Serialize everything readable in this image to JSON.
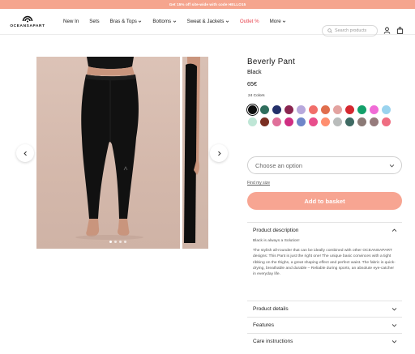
{
  "promo": {
    "text": "Get 15% off site-wide with code HELLO15"
  },
  "header": {
    "logo_text": "OCEANSAPART",
    "nav": [
      {
        "label": "New In",
        "dropdown": false,
        "highlight": false
      },
      {
        "label": "Sets",
        "dropdown": false,
        "highlight": false
      },
      {
        "label": "Bras & Tops",
        "dropdown": true,
        "highlight": false
      },
      {
        "label": "Bottoms",
        "dropdown": true,
        "highlight": false
      },
      {
        "label": "Sweat & Jackets",
        "dropdown": true,
        "highlight": false
      },
      {
        "label": "Outlet %",
        "dropdown": false,
        "highlight": true
      },
      {
        "label": "More",
        "dropdown": true,
        "highlight": false
      }
    ],
    "search_placeholder": "Search products",
    "icons": [
      "search-icon",
      "user-icon",
      "bag-icon"
    ]
  },
  "gallery": {
    "slide_count": 4,
    "active_slide": 1
  },
  "product": {
    "title": "Beverly Pant",
    "color_name": "Black",
    "price": "65€",
    "colors_count_label": "24 Colors",
    "swatches": [
      "#0d0d0d",
      "#2f6e5d",
      "#23306a",
      "#8a2550",
      "#b7a8dc",
      "#f16e6a",
      "#e06e4d",
      "#e3a3a0",
      "#d52830",
      "#13a06a",
      "#f06bd6",
      "#9ad3ee",
      "#bfe6d6",
      "#7a2f22",
      "#e0709a",
      "#cf2e82",
      "#6f86c9",
      "#e84e8c",
      "#ff8f70",
      "#b9bcbb",
      "#3f6a63",
      "#8b7a76",
      "#967b7c",
      "#ef6e82"
    ],
    "selected_swatch": 0,
    "size_select_placeholder": "Choose an option",
    "size_link": "Find my size",
    "add_to_basket": "Add to basket"
  },
  "accordions": {
    "description": {
      "title": "Product description",
      "lead": "Black is always a Solution!",
      "body": "The stylish all-rounder that can be ideally combined with other OCEANSAPART designs: This Pant is just the right one! The unique basic convinces with a tight ribbing on the thighs, a great shaping effect and perfect waist. The fabric is quick-drying, breathable and durable – Reliable during sports, an absolute eye-catcher in everyday life."
    },
    "details": {
      "title": "Product details"
    },
    "features": {
      "title": "Features"
    },
    "care": {
      "title": "Care instructions"
    }
  },
  "colors": {
    "accent": "#f7a592",
    "outlet": "#e8434e"
  }
}
